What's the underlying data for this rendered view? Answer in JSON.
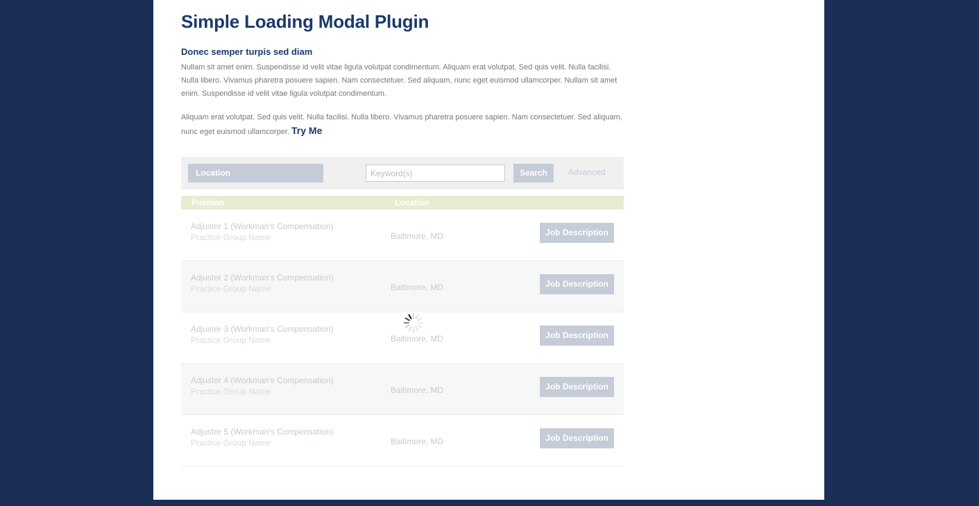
{
  "page": {
    "title": "Simple Loading Modal Plugin",
    "subtitle": "Donec semper turpis sed diam",
    "paragraph1": "Nullam sit amet enim. Suspendisse id velit vitae ligula volutpat condimentum. Aliquam erat volutpat. Sed quis velit. Nulla facilisi. Nulla libero. Vivamus pharetra posuere sapien. Nam consectetuer. Sed aliquam, nunc eget euismod ullamcorper. Nullam sit amet enim. Suspendisse id velit vitae ligula volutpat condimentum.",
    "paragraph2": "Aliquam erat volutpat. Sed quis velit. Nulla facilisi. Nulla libero. Vivamus pharetra posuere sapien. Nam consectetuer. Sed aliquam, nunc eget euismod ullamcorper.",
    "try_me": "Try Me"
  },
  "search": {
    "location_label": "Location",
    "keyword_placeholder": "Keyword(s)",
    "search_label": "Search",
    "advanced_label": "Advanced"
  },
  "table": {
    "columns": [
      "Position",
      "Location"
    ],
    "button_label": "Job Description",
    "rows": [
      {
        "title": "Adjuster 1 (Workman's Compensation)",
        "group": "Practice Group Name",
        "location": "Baltimore, MD"
      },
      {
        "title": "Adjuster 2 (Workman's Compensation)",
        "group": "Practice Group Name",
        "location": "Baltimore, MD"
      },
      {
        "title": "Adjuster 3 (Workman's Compensation)",
        "group": "Practice Group Name",
        "location": "Baltimore, MD"
      },
      {
        "title": "Adjuster 4 (Workman's Compensation)",
        "group": "Practice Group Name",
        "location": "Baltimore, MD"
      },
      {
        "title": "Adjuster 5 (Workman's Compensation)",
        "group": "Practice Group Name",
        "location": "Baltimore, MD"
      }
    ]
  },
  "colors": {
    "background": "#1a2e56",
    "heading": "#1a3a6b",
    "button_disabled": "#c5ccd7",
    "table_header": "#e8edd2"
  },
  "icons": {
    "loading": "loading-spinner-icon"
  }
}
